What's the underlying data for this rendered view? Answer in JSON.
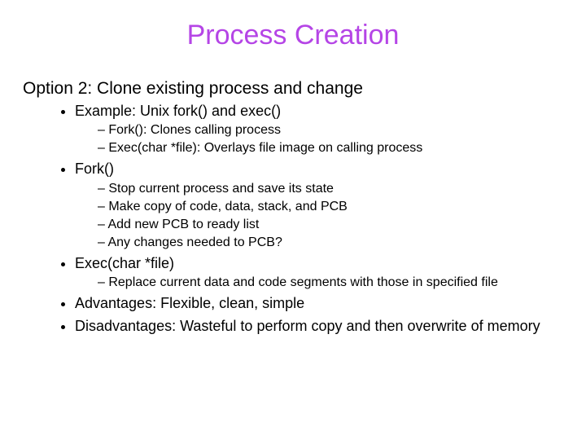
{
  "title_color": "#b545e6",
  "title": "Process Creation",
  "subtitle": "Option 2: Clone existing process and change",
  "bullets": {
    "b1": "Example: Unix fork() and exec()",
    "b1_1": "Fork(): Clones calling process",
    "b1_2": "Exec(char *file): Overlays file image on calling process",
    "b2": "Fork()",
    "b2_1": "Stop current process and save its state",
    "b2_2": "Make copy of code, data, stack, and PCB",
    "b2_3": "Add new PCB to ready list",
    "b2_4": "Any changes needed to PCB?",
    "b3": "Exec(char *file)",
    "b3_1": "Replace current data and code segments with those in specified file",
    "b4": "Advantages: Flexible, clean, simple",
    "b5": "Disadvantages: Wasteful to perform copy and then overwrite of memory"
  }
}
